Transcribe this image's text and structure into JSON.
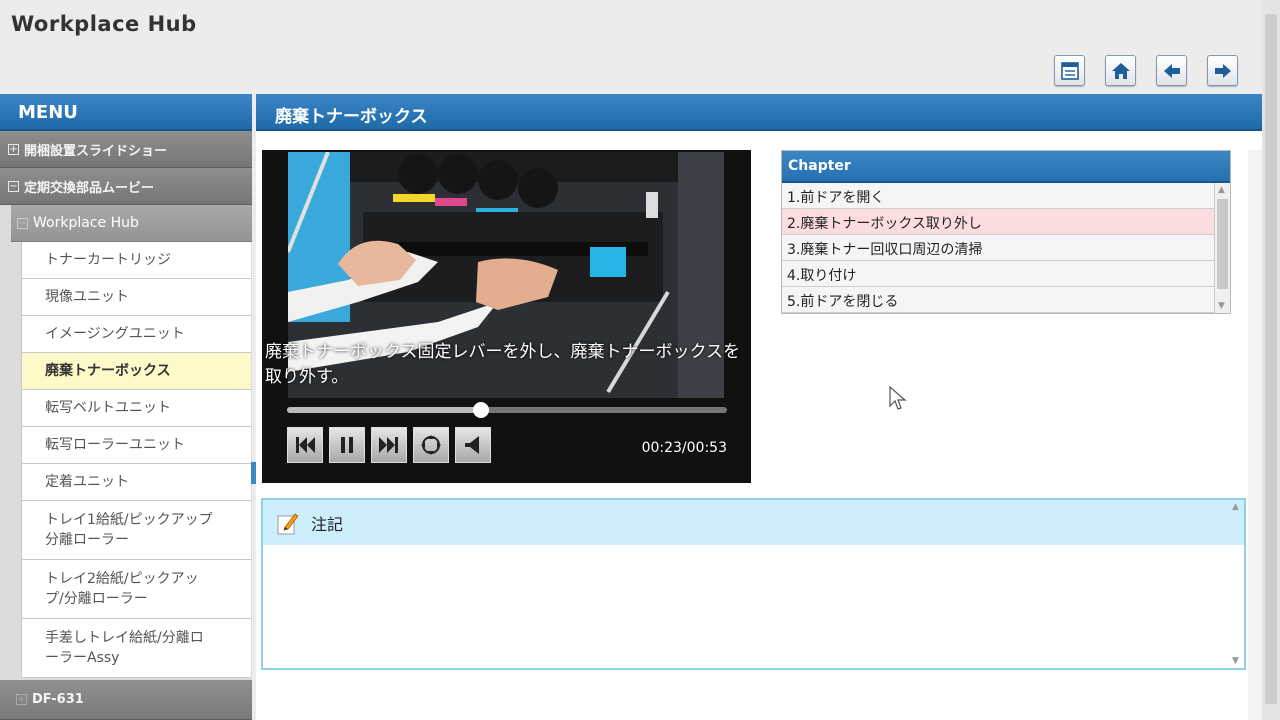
{
  "app": {
    "title": "Workplace Hub"
  },
  "toolbar": {
    "buttons": [
      "list-view-icon",
      "home-icon",
      "back-arrow-icon",
      "forward-arrow-icon"
    ]
  },
  "sidebar": {
    "menu_label": "MENU",
    "groups": [
      {
        "label": "開梱設置スライドショー",
        "state": "collapsed"
      },
      {
        "label": "定期交換部品ムービー",
        "state": "expanded"
      }
    ],
    "subgroup": {
      "label": "Workplace Hub",
      "state": "expanded"
    },
    "items": [
      {
        "label": "トナーカートリッジ",
        "active": false
      },
      {
        "label": "現像ユニット",
        "active": false
      },
      {
        "label": "イメージングユニット",
        "active": false
      },
      {
        "label": "廃棄トナーボックス",
        "active": true
      },
      {
        "label": "転写ベルトユニット",
        "active": false
      },
      {
        "label": "転写ローラーユニット",
        "active": false
      },
      {
        "label": "定着ユニット",
        "active": false
      },
      {
        "label": "トレイ1給紙/ピックアップ\n分離ローラー",
        "active": false
      },
      {
        "label": "トレイ2給紙/ピックアッ\nプ/分離ローラー",
        "active": false
      },
      {
        "label": "手差しトレイ給紙/分離ロ\nーラーAssy",
        "active": false
      }
    ],
    "bottom_group": {
      "label": "DF-631",
      "state": "collapsed"
    }
  },
  "main": {
    "title": "廃棄トナーボックス",
    "video": {
      "subtitle": "廃棄トナーボックス固定レバーを外し、廃棄トナーボックスを取り外す。",
      "time": "00:23/00:53",
      "progress": 0.44,
      "controls": [
        "previous-chapter-icon",
        "pause-icon",
        "next-chapter-icon",
        "fullscreen-icon",
        "volume-icon"
      ]
    },
    "chapters": {
      "header": "Chapter",
      "items": [
        {
          "label": "1.前ドアを開く",
          "active": false
        },
        {
          "label": "2.廃棄トナーボックス取り外し",
          "active": true
        },
        {
          "label": "3.廃棄トナー回収口周辺の清掃",
          "active": false
        },
        {
          "label": "4.取り付け",
          "active": false
        },
        {
          "label": "5.前ドアを閉じる",
          "active": false
        }
      ]
    },
    "notes": {
      "header": "注記",
      "body": ""
    }
  },
  "colors": {
    "header_blue": "#2b78b9",
    "active_menu": "#fdf9c8",
    "active_chapter": "#fbdde0",
    "notes_header": "#cdeefb"
  }
}
